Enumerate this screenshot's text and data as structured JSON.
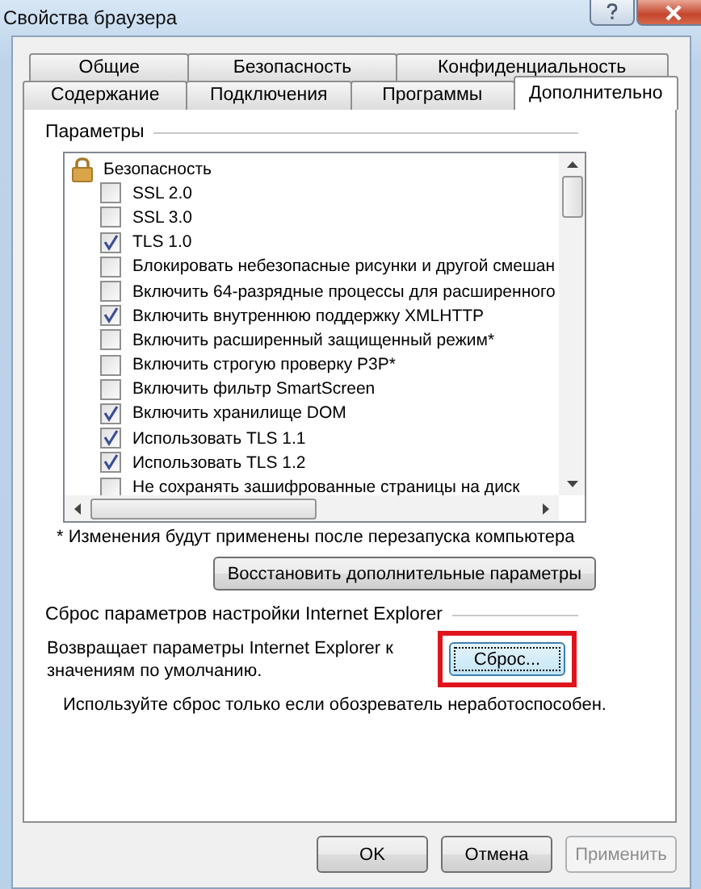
{
  "window": {
    "title": "Свойства браузера"
  },
  "tabs_top": [
    {
      "label": "Общие",
      "selected": false
    },
    {
      "label": "Безопасность",
      "selected": false
    },
    {
      "label": "Конфиденциальность",
      "selected": false
    }
  ],
  "tabs_bottom": [
    {
      "label": "Содержание",
      "selected": false
    },
    {
      "label": "Подключения",
      "selected": false
    },
    {
      "label": "Программы",
      "selected": false
    },
    {
      "label": "Дополнительно",
      "selected": true
    }
  ],
  "settings": {
    "title": "Параметры",
    "items": [
      {
        "kind": "group",
        "label": "Безопасность"
      },
      {
        "kind": "checkbox",
        "label": "SSL 2.0",
        "checked": false
      },
      {
        "kind": "checkbox",
        "label": "SSL 3.0",
        "checked": false
      },
      {
        "kind": "checkbox",
        "label": "TLS 1.0",
        "checked": true
      },
      {
        "kind": "checkbox",
        "label": "Блокировать небезопасные рисунки и другой смешан",
        "checked": false
      },
      {
        "kind": "checkbox",
        "label": "Включить 64-разрядные процессы для расширенного",
        "checked": false
      },
      {
        "kind": "checkbox",
        "label": "Включить внутреннюю поддержку XMLHTTP",
        "checked": true
      },
      {
        "kind": "checkbox",
        "label": "Включить расширенный защищенный режим*",
        "checked": false
      },
      {
        "kind": "checkbox",
        "label": "Включить строгую проверку P3P*",
        "checked": false
      },
      {
        "kind": "checkbox",
        "label": "Включить фильтр SmartScreen",
        "checked": false
      },
      {
        "kind": "checkbox",
        "label": "Включить хранилище DOM",
        "checked": true
      },
      {
        "kind": "checkbox",
        "label": "Использовать TLS 1.1",
        "checked": true
      },
      {
        "kind": "checkbox",
        "label": "Использовать TLS 1.2",
        "checked": true
      },
      {
        "kind": "checkbox",
        "label": "Не сохранять зашифрованные страницы на диск",
        "checked": false
      }
    ],
    "note": "* Изменения будут применены после перезапуска компьютера",
    "restore_button": "Восстановить дополнительные параметры"
  },
  "reset": {
    "title": "Сброс параметров настройки Internet Explorer",
    "description": "Возвращает параметры Internet Explorer к значениям по умолчанию.",
    "button": "Сброс...",
    "hint": "Используйте сброс только если обозреватель неработоспособен."
  },
  "buttons": [
    {
      "label": "OK",
      "disabled": false
    },
    {
      "label": "Отмена",
      "disabled": false
    },
    {
      "label": "Применить",
      "disabled": true
    }
  ]
}
